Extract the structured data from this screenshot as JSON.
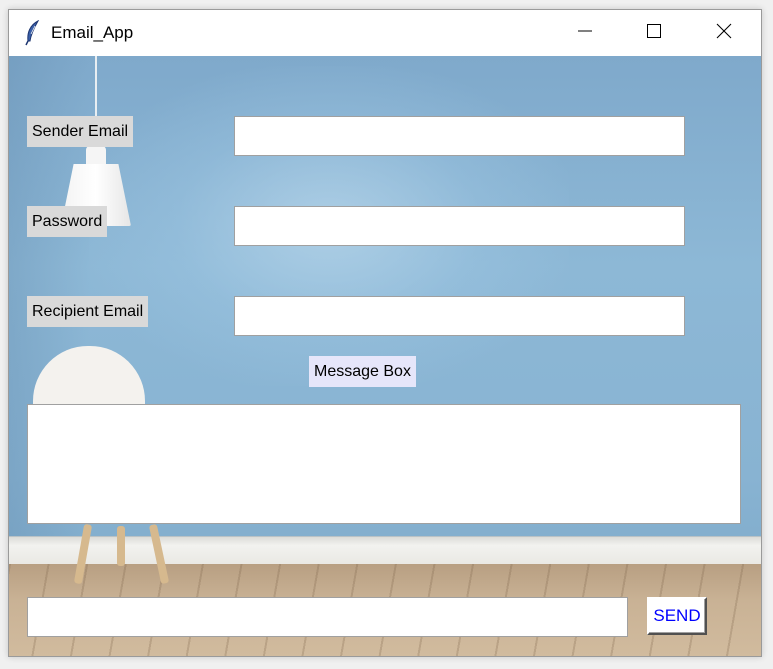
{
  "window": {
    "title": "Email_App",
    "icon": "feather-icon",
    "controls": [
      "minimize-icon",
      "maximize-icon",
      "close-icon"
    ]
  },
  "form": {
    "sender_label": "Sender Email",
    "sender_value": "",
    "password_label": "Password",
    "password_value": "",
    "recipient_label": "Recipient Email",
    "recipient_value": "",
    "message_label": "Message Box",
    "message_value": "",
    "status_value": "",
    "send_label": "SEND"
  },
  "colors": {
    "label_bg": "#d9d9d9",
    "message_label_bg": "#e6e6fa",
    "send_text": "#0000ff",
    "wall": "#8db8d6"
  }
}
